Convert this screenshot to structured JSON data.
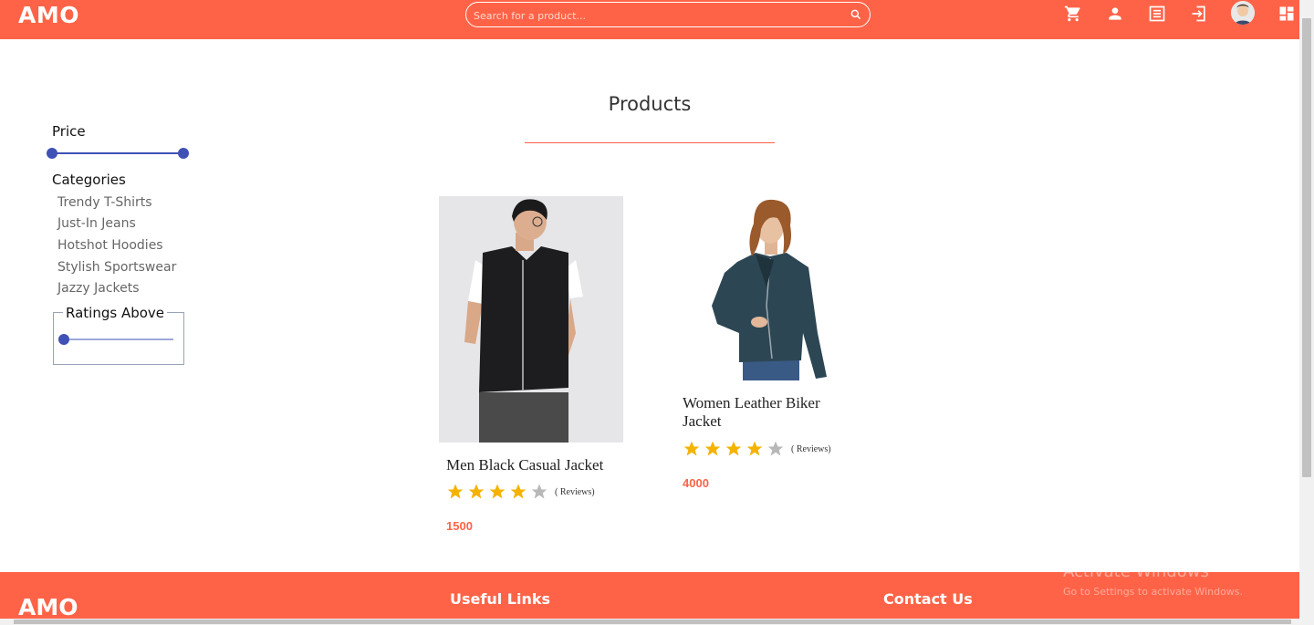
{
  "header": {
    "brand": "AMO",
    "search_placeholder": "Search for a product...",
    "icons": [
      "search-icon",
      "cart-icon",
      "user-icon",
      "orders-icon",
      "login-icon",
      "avatar",
      "dashboard-icon"
    ]
  },
  "sidebar": {
    "price_label": "Price",
    "categories_label": "Categories",
    "categories": [
      "Trendy T-Shirts",
      "Just-In Jeans",
      "Hotshot Hoodies",
      "Stylish Sportswear",
      "Jazzy Jackets"
    ],
    "ratings_label": "Ratings Above",
    "ratings_value": 0
  },
  "main": {
    "title": "Products",
    "products": [
      {
        "name": "Men Black Casual Jacket",
        "rating": 4,
        "reviews": "( Reviews)",
        "price": "1500"
      },
      {
        "name": "Women Leather Biker Jacket",
        "rating": 4,
        "reviews": "( Reviews)",
        "price": "4000"
      }
    ]
  },
  "footer": {
    "brand": "AMO",
    "useful_links": "Useful Links",
    "contact_us": "Contact Us"
  },
  "watermark": {
    "line1": "Activate Windows",
    "line2": "Go to Settings to activate Windows."
  },
  "colors": {
    "accent": "#ff6347",
    "slider": "#3f51b5",
    "star_filled": "#f5b301",
    "star_empty": "#b8b8b8"
  }
}
